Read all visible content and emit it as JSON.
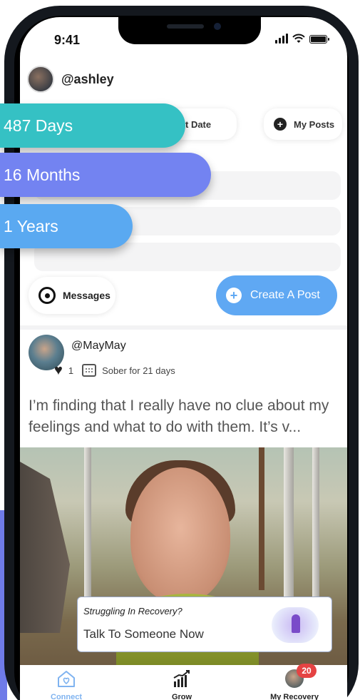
{
  "status_bar": {
    "time": "9:41"
  },
  "profile": {
    "username": "@ashley"
  },
  "chips": {
    "date_label": "t Date",
    "my_posts_label": "My Posts"
  },
  "pills": {
    "days": "487 Days",
    "months": "16 Months",
    "years": "1 Years"
  },
  "actions": {
    "messages_label": "Messages",
    "create_post_label": "Create A Post"
  },
  "post": {
    "username": "@MayMay",
    "likes": "1",
    "sober_text": "Sober for 21 days",
    "body": "I’m finding that I really have no clue about my feelings and what to do with them. It’s v..."
  },
  "callout": {
    "title": "Struggling In Recovery?",
    "subtitle": "Talk To Someone Now"
  },
  "tabbar": {
    "tabs": [
      {
        "label": "Connect",
        "icon": "heart-house-icon",
        "active": true
      },
      {
        "label": "Grow",
        "icon": "growth-chart-icon",
        "active": false
      },
      {
        "label": "My Recovery",
        "icon": "avatar-icon",
        "active": false,
        "badge": "20"
      }
    ]
  },
  "colors": {
    "teal": "#35c1c4",
    "violet": "#7383f1",
    "blue": "#5aa9f1",
    "accent": "#5fa8f3",
    "badge": "#e54343"
  }
}
